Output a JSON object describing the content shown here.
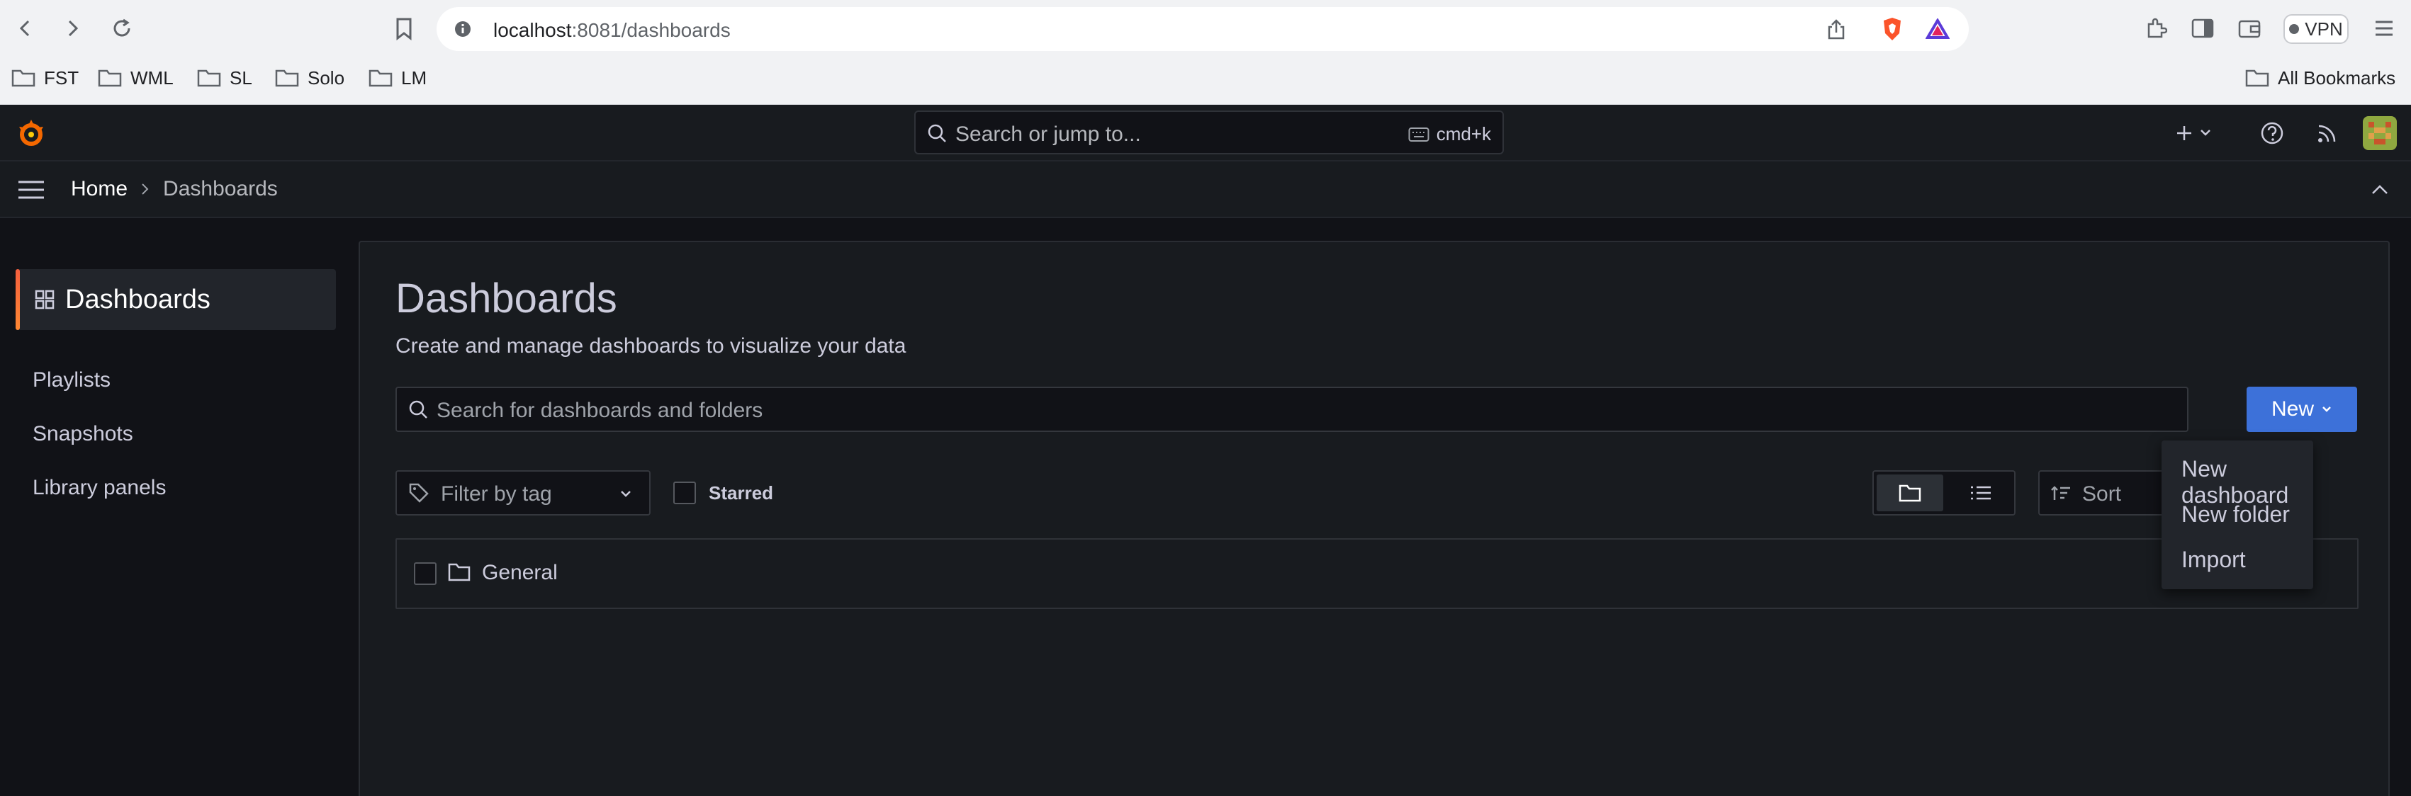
{
  "browser": {
    "url_host": "localhost",
    "url_path": ":8081/dashboards",
    "vpn_label": "VPN",
    "bookmarks": [
      {
        "label": "FST"
      },
      {
        "label": "WML"
      },
      {
        "label": "SL"
      },
      {
        "label": "Solo"
      },
      {
        "label": "LM"
      }
    ],
    "all_bookmarks": "All Bookmarks"
  },
  "grafana": {
    "search_placeholder": "Search or jump to...",
    "search_shortcut": "cmd+k",
    "breadcrumb": {
      "home": "Home",
      "current": "Dashboards"
    }
  },
  "sidebar": {
    "active": "Dashboards",
    "items": [
      {
        "label": "Playlists"
      },
      {
        "label": "Snapshots"
      },
      {
        "label": "Library panels"
      }
    ]
  },
  "main": {
    "title": "Dashboards",
    "subtitle": "Create and manage dashboards to visualize your data",
    "search_placeholder": "Search for dashboards and folders",
    "new_button": "New",
    "filter_placeholder": "Filter by tag",
    "starred_label": "Starred",
    "sort_label": "Sort",
    "rows": [
      {
        "label": "General"
      }
    ]
  },
  "new_menu": {
    "items": [
      {
        "label": "New dashboard"
      },
      {
        "label": "New folder"
      },
      {
        "label": "Import"
      }
    ]
  },
  "colors": {
    "accent_blue": "#3d71d9",
    "active_orange": "#f55f3e",
    "background": "#111217",
    "panel": "#181b1f"
  }
}
